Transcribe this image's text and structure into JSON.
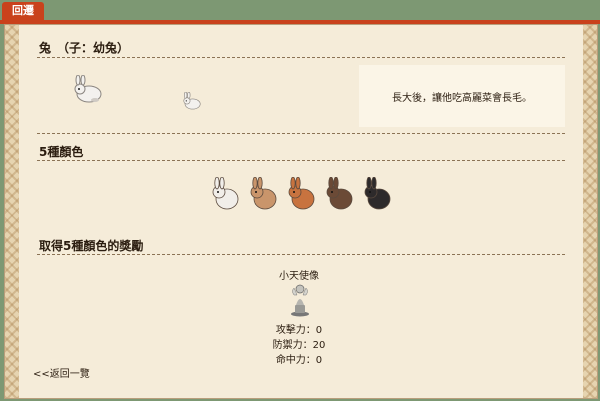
{
  "tab": {
    "label": "回遷"
  },
  "section1": {
    "title": "兔　（子：幼兔）",
    "note": "長大後，讓他吃高麗菜會長毛。"
  },
  "section2": {
    "title": "5種顏色",
    "rabbits": [
      {
        "name": "white",
        "color": "#f1eee9"
      },
      {
        "name": "tan",
        "color": "#c9956b"
      },
      {
        "name": "orange",
        "color": "#c8733f"
      },
      {
        "name": "brown",
        "color": "#6b4a36"
      },
      {
        "name": "black",
        "color": "#2d2a2b"
      }
    ]
  },
  "section3": {
    "title": "取得5種顏色的獎勵",
    "reward_name": "小天使像",
    "stats": [
      "攻擊力：0",
      "防禦力：20",
      "命中力：0"
    ]
  },
  "footer": {
    "back_label": "<<返回一覽"
  }
}
